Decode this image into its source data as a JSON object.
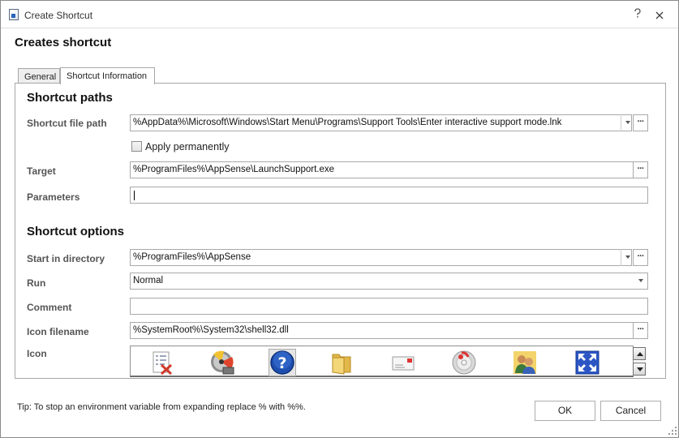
{
  "window": {
    "title": "Create Shortcut"
  },
  "heading": "Creates shortcut",
  "tabs": [
    {
      "label": "General",
      "active": false
    },
    {
      "label": "Shortcut Information",
      "active": true
    }
  ],
  "shortcut_paths": {
    "title": "Shortcut paths",
    "file_path": {
      "label": "Shortcut file path",
      "value": "%AppData%\\Microsoft\\Windows\\Start Menu\\Programs\\Support Tools\\Enter interactive support mode.lnk"
    },
    "apply_permanently": {
      "label": "Apply permanently",
      "checked": false
    },
    "target": {
      "label": "Target",
      "value": "%ProgramFiles%\\AppSense\\LaunchSupport.exe"
    },
    "parameters": {
      "label": "Parameters",
      "value": ""
    }
  },
  "shortcut_options": {
    "title": "Shortcut options",
    "start_in": {
      "label": "Start in directory",
      "value": "%ProgramFiles%\\AppSense"
    },
    "run": {
      "label": "Run",
      "value": "Normal"
    },
    "comment": {
      "label": "Comment",
      "value": ""
    },
    "icon_filename": {
      "label": "Icon filename",
      "value": "%SystemRoot%\\System32\\shell32.dll"
    },
    "icon": {
      "label": "Icon"
    }
  },
  "icons": [
    "checklist-delete-icon",
    "disc-drive-icon",
    "help-icon",
    "folder-icon",
    "mail-envelope-icon",
    "cd-music-icon",
    "users-icon",
    "fullscreen-arrows-icon"
  ],
  "ellipsis": "···",
  "tip": "Tip: To stop an environment variable from expanding replace % with %%.",
  "buttons": {
    "ok": "OK",
    "cancel": "Cancel"
  }
}
